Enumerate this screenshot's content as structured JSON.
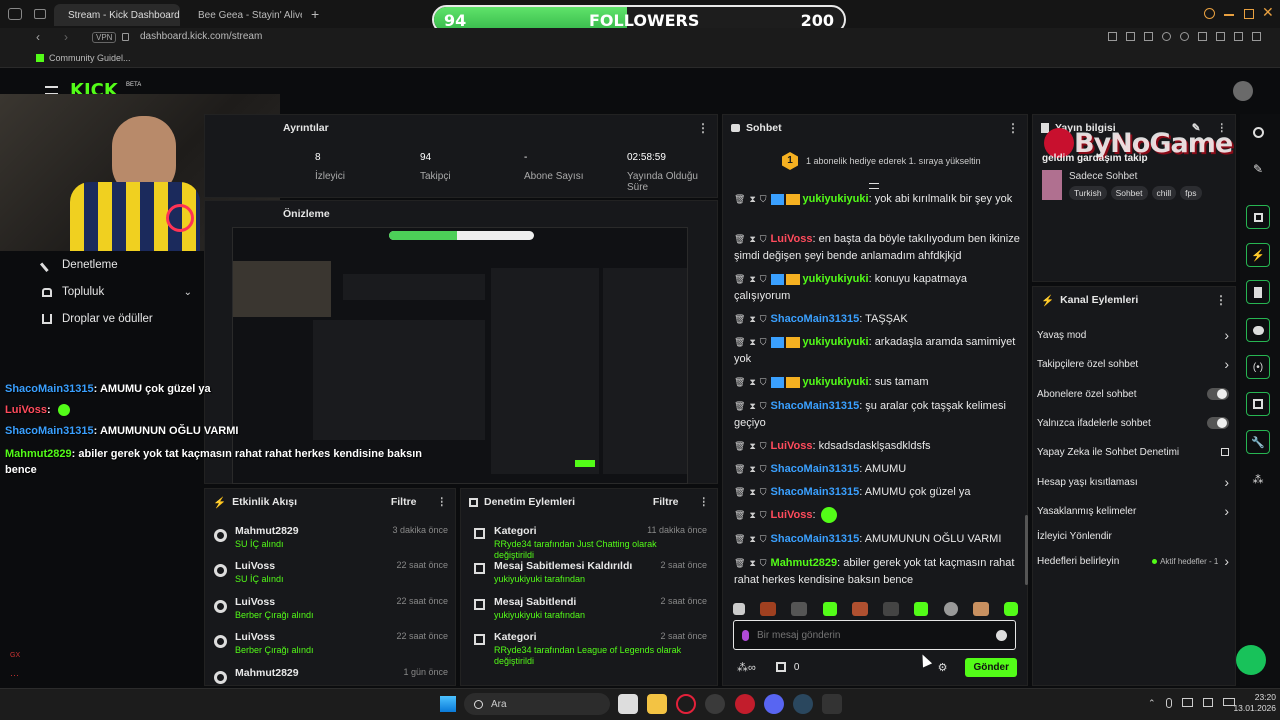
{
  "browser": {
    "tabs": [
      {
        "label": "Stream - Kick Dashboard"
      },
      {
        "label": "Bee Geea - Stayin' Alive"
      }
    ],
    "vpn": "VPN",
    "url": "dashboard.kick.com/stream",
    "bookmark": "Community Guidel..."
  },
  "goal": {
    "current": "94",
    "label": "FOLLOWERS",
    "target": "200",
    "progress": 0.47
  },
  "kick": {
    "logo": "KICK",
    "beta": "BETA"
  },
  "stats": {
    "title": "Ayrıntılar",
    "items": [
      {
        "value": "8",
        "label": "İzleyici"
      },
      {
        "value": "94",
        "label": "Takipçi"
      },
      {
        "value": "-",
        "label": "Abone Sayısı"
      },
      {
        "value": "02:58:59",
        "label": "Yayında Olduğu Süre"
      }
    ]
  },
  "preview": {
    "title": "Önizleme"
  },
  "nav": [
    {
      "label": "Denetleme"
    },
    {
      "label": "Topluluk"
    },
    {
      "label": "Droplar ve ödüller"
    }
  ],
  "overlay_chat": [
    {
      "user": "ShacoMain31315",
      "text": ": AMUMU çok güzel ya",
      "color": "#3aa0ff"
    },
    {
      "user": "LuiVoss",
      "text": ":",
      "color": "#ff4b5c"
    },
    {
      "user": "ShacoMain31315",
      "text": ": AMUMUNUN OĞLU VARMI",
      "color": "#3aa0ff"
    },
    {
      "user": "Mahmut2829",
      "text": ": abiler gerek yok tat kaçmasın rahat rahat herkes kendisine baksın bence",
      "color": "#53fc18"
    }
  ],
  "chat": {
    "title": "Sohbet",
    "sub_notice": "1 abonelik hediye ederek 1. sıraya yükseltin",
    "sub_badge": "1",
    "messages": [
      {
        "user": "yukiyukiyuki",
        "cls": "u-yuki",
        "text": ": yok abi kırılmalık bir şey yok"
      },
      {
        "user": "LuiVoss",
        "cls": "u-lui",
        "text": ": en başta da böyle takılıyodum ben ikinize şimdi değişen şeyi bende anlamadım ahfdkjkjd"
      },
      {
        "user": "yukiyukiyuki",
        "cls": "u-yuki",
        "text": ": konuyu kapatmaya çalışıyorum"
      },
      {
        "user": "ShacoMain31315",
        "cls": "u-shaco",
        "text": ": TAŞŞAK"
      },
      {
        "user": "yukiyukiyuki",
        "cls": "u-yuki",
        "text": ": arkadaşla aramda samimiyet yok"
      },
      {
        "user": "yukiyukiyuki",
        "cls": "u-yuki",
        "text": ": sus tamam"
      },
      {
        "user": "ShacoMain31315",
        "cls": "u-shaco",
        "text": ": şu aralar çok taşşak kelimesi geçiyo"
      },
      {
        "user": "LuiVoss",
        "cls": "u-lui",
        "text": ": kdsadsdasklşasdkldsfs"
      },
      {
        "user": "ShacoMain31315",
        "cls": "u-shaco",
        "text": ": AMUMU"
      },
      {
        "user": "ShacoMain31315",
        "cls": "u-shaco",
        "text": ": AMUMU çok güzel ya"
      },
      {
        "user": "LuiVoss",
        "cls": "u-lui",
        "text": ":"
      },
      {
        "user": "ShacoMain31315",
        "cls": "u-shaco",
        "text": ": AMUMUNUN OĞLU VARMI"
      },
      {
        "user": "Mahmut2829",
        "cls": "u-mahmut",
        "text": ": abiler gerek yok tat kaçmasın rahat rahat herkes kendisine baksın bence"
      }
    ],
    "input_placeholder": "Bir mesaj gönderin",
    "count": "0",
    "send_label": "Gönder"
  },
  "stream_info": {
    "title": "Yayın bilgisi",
    "stream_title": "geldim gardaşım takip",
    "category": "Sadece Sohbet",
    "tags": [
      "Turkish",
      "Sohbet",
      "chill",
      "fps"
    ],
    "watermark": "ByNoGame"
  },
  "channel_actions": {
    "title": "Kanal Eylemleri",
    "items": [
      {
        "label": "Yavaş mod",
        "kind": "chevron"
      },
      {
        "label": "Takipçilere özel sohbet",
        "kind": "chevron"
      },
      {
        "label": "Abonelere özel sohbet",
        "kind": "toggle"
      },
      {
        "label": "Yalnızca ifadelerle sohbet",
        "kind": "toggle"
      },
      {
        "label": "Yapay Zeka ile Sohbet Denetimi",
        "kind": "external"
      },
      {
        "label": "Hesap yaşı kısıtlaması",
        "kind": "chevron"
      },
      {
        "label": "Yasaklanmış kelimeler",
        "kind": "chevron"
      },
      {
        "label": "İzleyici Yönlendir",
        "kind": "none"
      },
      {
        "label": "Hedefleri belirleyin",
        "kind": "chevron",
        "extra": "Aktif hedefler - 1"
      }
    ]
  },
  "activity": {
    "title": "Etkinlik Akışı",
    "filter": "Filtre",
    "items": [
      {
        "user": "Mahmut2829",
        "sub": "SU İÇ alındı",
        "time": "3 dakika önce"
      },
      {
        "user": "LuiVoss",
        "sub": "SU İÇ alındı",
        "time": "22 saat önce"
      },
      {
        "user": "LuiVoss",
        "sub": "Berber Çırağı alındı",
        "time": "22 saat önce"
      },
      {
        "user": "LuiVoss",
        "sub": "Berber Çırağı alındı",
        "time": "22 saat önce"
      },
      {
        "user": "Mahmut2829",
        "sub": "",
        "time": "1 gün önce"
      }
    ]
  },
  "moderation": {
    "title": "Denetim Eylemleri",
    "filter": "Filtre",
    "items": [
      {
        "title": "Kategori",
        "sub": "RRyde34 tarafından Just Chatting olarak değiştirildi",
        "time": "11 dakika önce"
      },
      {
        "title": "Mesaj Sabitlemesi Kaldırıldı",
        "sub": "yukiyukiyuki tarafından",
        "time": "2 saat önce"
      },
      {
        "title": "Mesaj Sabitlendi",
        "sub": "yukiyukiyuki tarafından",
        "time": "2 saat önce"
      },
      {
        "title": "Kategori",
        "sub": "RRyde34 tarafından League of Legends olarak değiştirildi",
        "time": "2 saat önce"
      }
    ]
  },
  "taskbar": {
    "search": "Ara",
    "time": "23:20",
    "date": "13.01.2026"
  },
  "colors": {
    "accent": "#53fc18",
    "panel": "#17181b",
    "bg": "#0b0c0e"
  }
}
